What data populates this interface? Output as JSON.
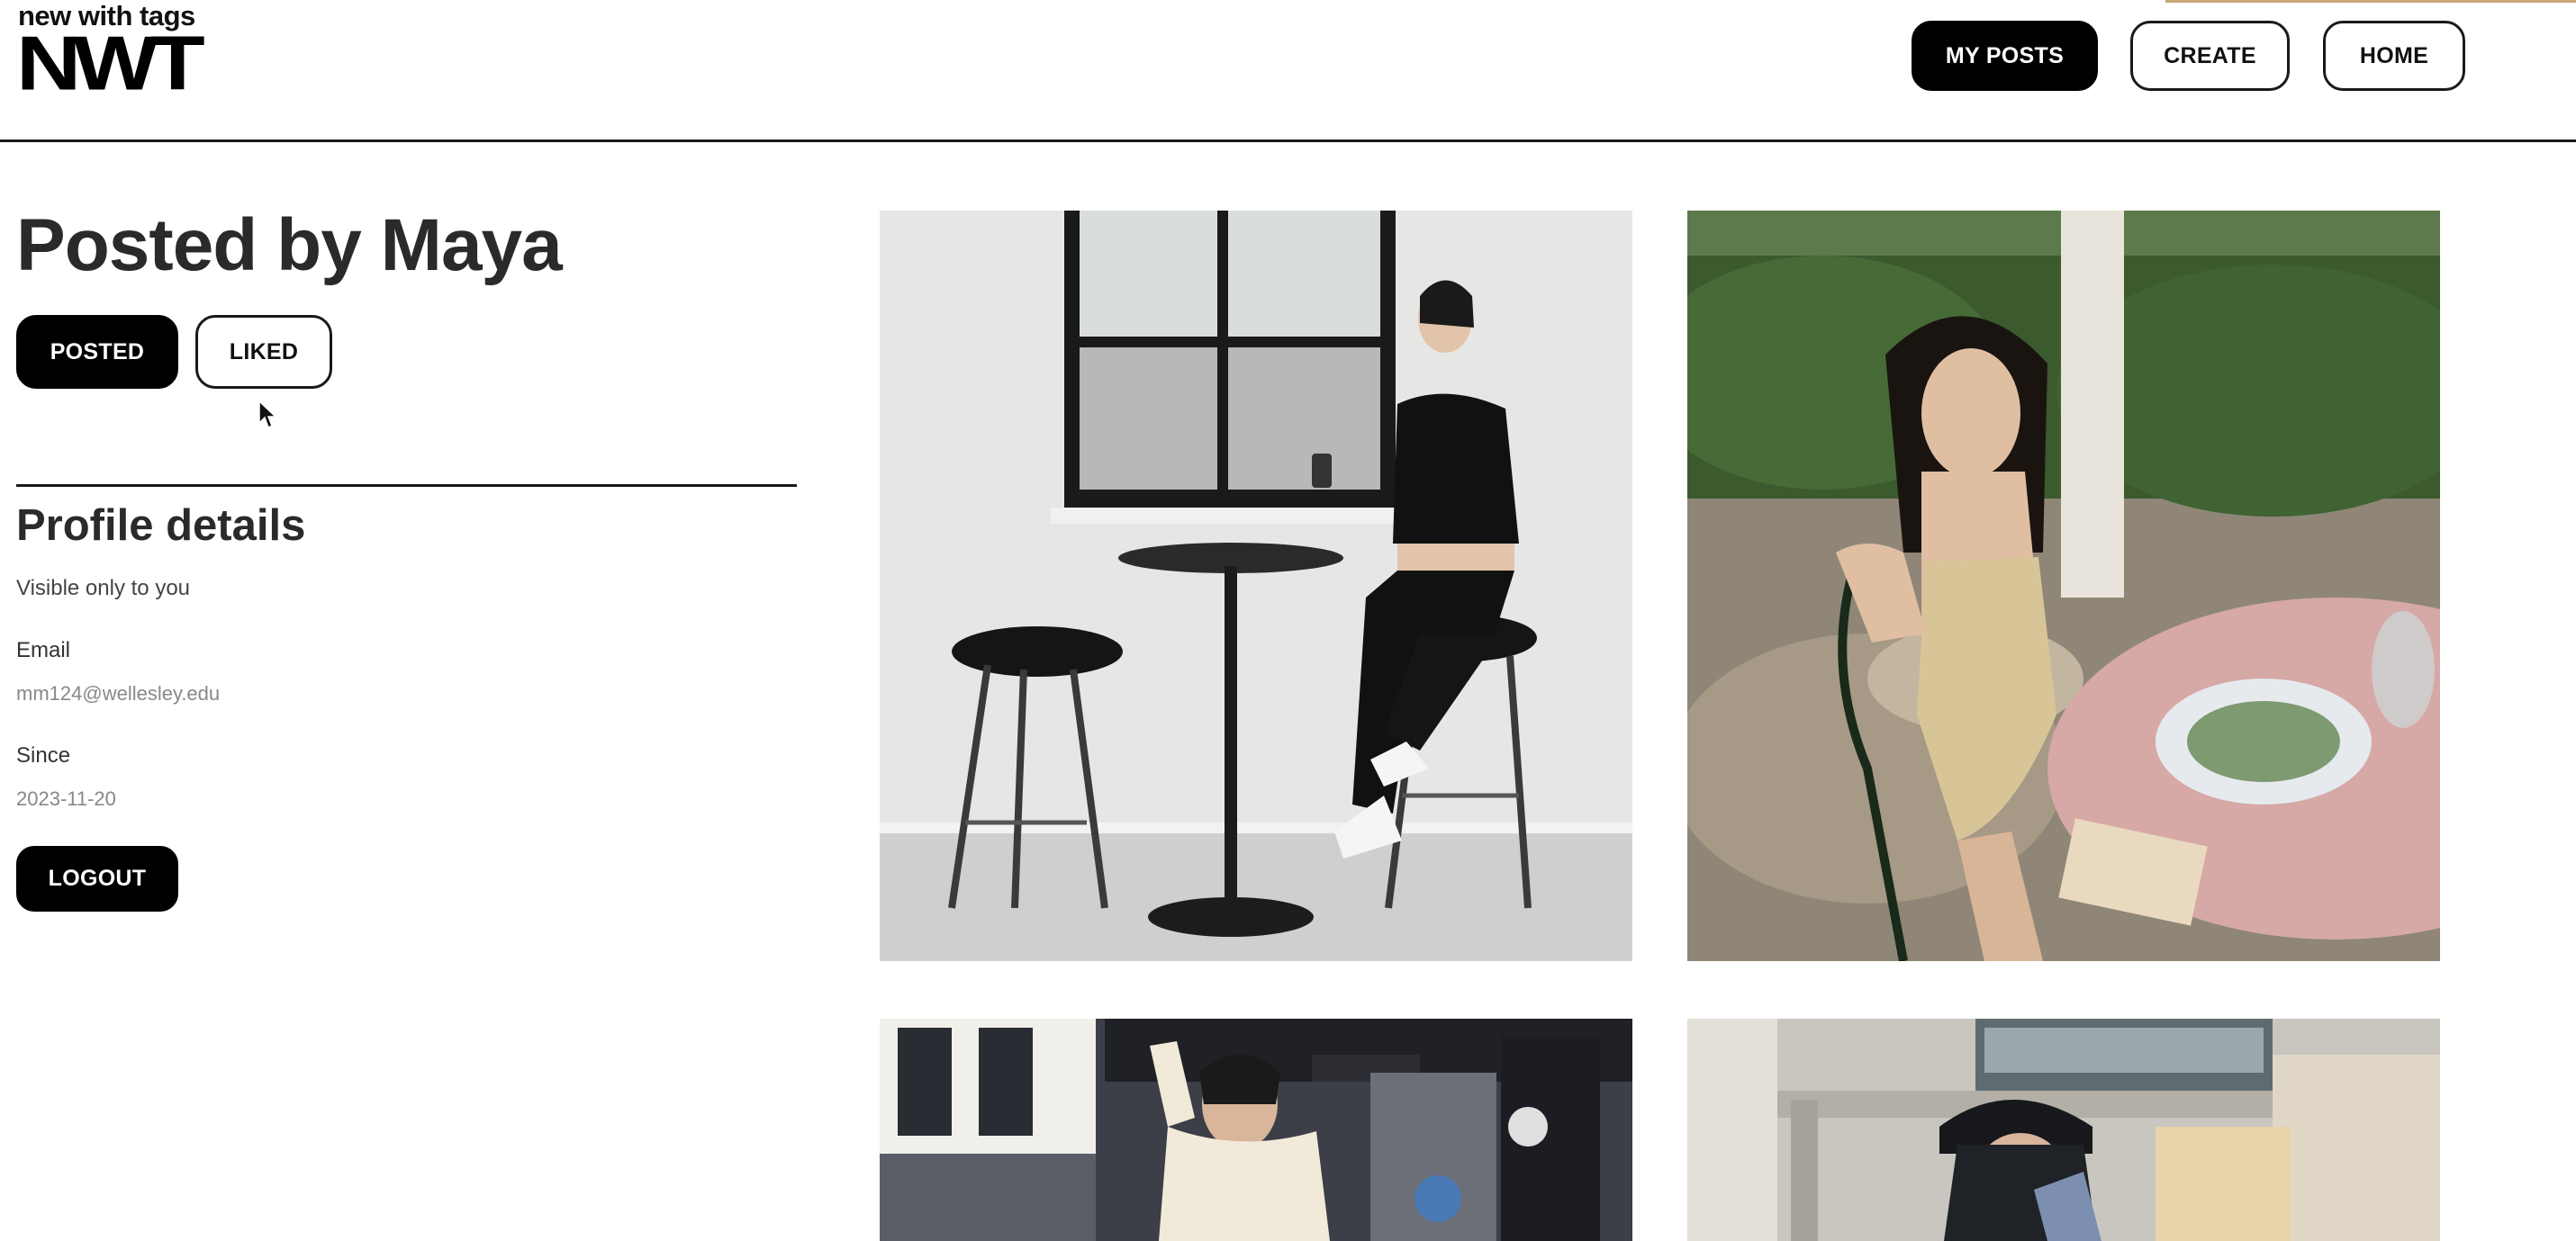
{
  "brand": {
    "tagline": "new with tags",
    "mark": "NWT"
  },
  "nav": {
    "my_posts": "MY POSTS",
    "create": "CREATE",
    "home": "HOME"
  },
  "profile": {
    "title": "Posted by Maya",
    "tabs": {
      "posted": "POSTED",
      "liked": "LIKED",
      "active": "POSTED"
    },
    "details": {
      "heading": "Profile details",
      "visibility_note": "Visible only to you",
      "email_label": "Email",
      "email_value": "mm124@wellesley.edu",
      "since_label": "Since",
      "since_value": "2023-11-20"
    },
    "logout_label": "LOGOUT"
  },
  "posts": [
    {
      "subject": "woman in black outfit on bar stool by window"
    },
    {
      "subject": "woman in floral dress at outdoor dining table"
    },
    {
      "subject": "woman on street with graffiti storefronts"
    },
    {
      "subject": "person in black cap under building archway"
    }
  ],
  "colors": {
    "primary": "#000000",
    "border": "#1a1a1a",
    "muted_text": "#888888"
  }
}
